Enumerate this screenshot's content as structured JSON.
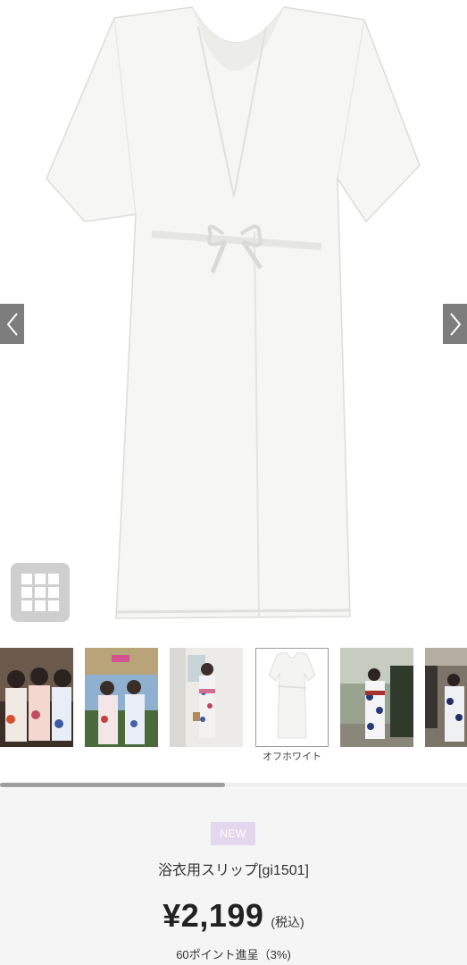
{
  "gallery": {
    "prev_icon": "chevron-left-icon",
    "next_icon": "chevron-right-icon",
    "grid_icon": "grid-icon"
  },
  "thumbnails": [
    {
      "id": "thumb-1",
      "caption": ""
    },
    {
      "id": "thumb-2",
      "caption": ""
    },
    {
      "id": "thumb-3",
      "caption": ""
    },
    {
      "id": "thumb-4",
      "caption": "オフホワイト",
      "selected": true
    },
    {
      "id": "thumb-5",
      "caption": ""
    },
    {
      "id": "thumb-6",
      "caption": ""
    }
  ],
  "product": {
    "badge": "NEW",
    "name": "浴衣用スリップ[gi1501]",
    "price": "¥2,199",
    "tax_label": "(税込)",
    "points": "60ポイント進呈（3%)"
  },
  "colors": {
    "badge_bg": "#e3d7ed",
    "arrow_bg": "#7d7d7d",
    "info_bg": "#f5f5f5"
  }
}
